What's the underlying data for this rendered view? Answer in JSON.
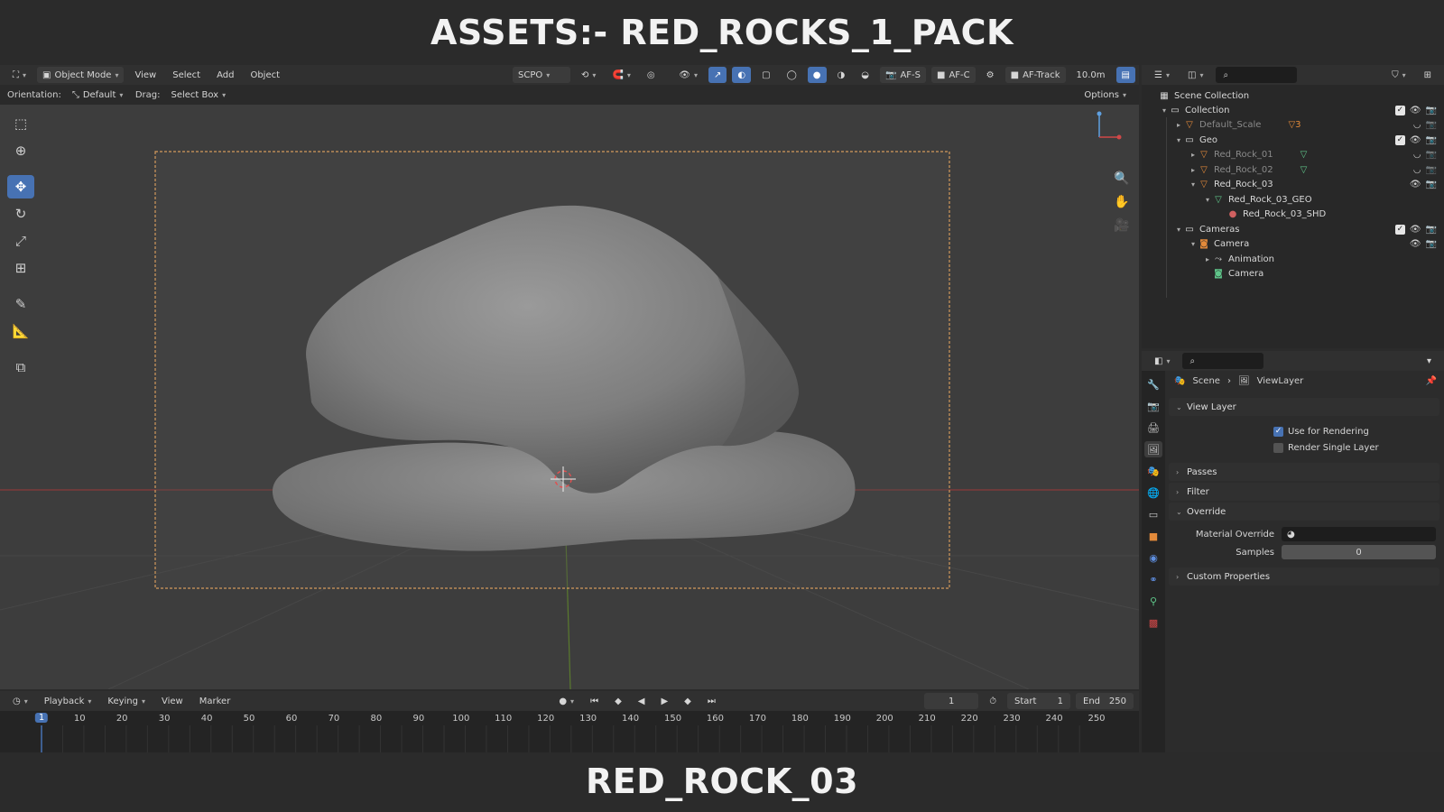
{
  "banner": {
    "top_title": "ASSETS:- RED_ROCKS_1_PACK",
    "bottom_title": "RED_ROCK_03"
  },
  "viewport_header": {
    "mode": "Object Mode",
    "menus": [
      "View",
      "Select",
      "Add",
      "Object"
    ],
    "camera_name": "SCPO",
    "af_s": "AF-S",
    "af_c": "AF-C",
    "af_track": "AF-Track",
    "distance": "10.0m"
  },
  "tool_settings": {
    "orientation_label": "Orientation:",
    "orientation_value": "Default",
    "drag_label": "Drag:",
    "drag_value": "Select Box",
    "options_label": "Options"
  },
  "timeline": {
    "menus": [
      "Playback",
      "Keying",
      "View",
      "Marker"
    ],
    "current_frame": "1",
    "start_label": "Start",
    "start_value": "1",
    "end_label": "End",
    "end_value": "250",
    "ticks": [
      "10",
      "20",
      "30",
      "40",
      "50",
      "60",
      "70",
      "80",
      "90",
      "100",
      "110",
      "120",
      "130",
      "140",
      "150",
      "160",
      "170",
      "180",
      "190",
      "200",
      "210",
      "220",
      "230",
      "240",
      "250"
    ],
    "cursor_label": "1"
  },
  "outliner": {
    "root": "Scene Collection",
    "rows": [
      {
        "label": "Collection",
        "level": 1,
        "icon": "collection-icon",
        "expanded": true,
        "dim": false
      },
      {
        "label": "Default_Scale",
        "level": 2,
        "icon": "mesh-icon",
        "expanded": false,
        "dim": true
      },
      {
        "label": "Geo",
        "level": 2,
        "icon": "collection-icon",
        "expanded": true,
        "dim": false
      },
      {
        "label": "Red_Rock_01",
        "level": 3,
        "icon": "mesh-icon",
        "expanded": false,
        "dim": true
      },
      {
        "label": "Red_Rock_02",
        "level": 3,
        "icon": "mesh-icon",
        "expanded": false,
        "dim": true
      },
      {
        "label": "Red_Rock_03",
        "level": 3,
        "icon": "mesh-icon",
        "expanded": true,
        "dim": false
      },
      {
        "label": "Red_Rock_03_GEO",
        "level": 4,
        "icon": "mesh-data-icon",
        "expanded": true,
        "dim": false
      },
      {
        "label": "Red_Rock_03_SHD",
        "level": 5,
        "icon": "material-icon",
        "expanded": false,
        "dim": false
      },
      {
        "label": "Cameras",
        "level": 2,
        "icon": "collection-icon",
        "expanded": true,
        "dim": false
      },
      {
        "label": "Camera",
        "level": 3,
        "icon": "camera-object-icon",
        "expanded": true,
        "dim": false
      },
      {
        "label": "Animation",
        "level": 4,
        "icon": "animation-icon",
        "expanded": false,
        "dim": false
      },
      {
        "label": "Camera",
        "level": 4,
        "icon": "camera-data-icon",
        "expanded": false,
        "dim": false
      }
    ],
    "default_scale_badge": "3"
  },
  "properties": {
    "breadcrumb_scene": "Scene",
    "breadcrumb_layer": "ViewLayer",
    "panels": {
      "view_layer": "View Layer",
      "use_for_rendering": "Use for Rendering",
      "render_single_layer": "Render Single Layer",
      "passes": "Passes",
      "filter": "Filter",
      "override": "Override",
      "material_override": "Material Override",
      "samples_label": "Samples",
      "samples_value": "0",
      "custom_properties": "Custom Properties"
    }
  },
  "colors": {
    "accent": "#4772b3",
    "mesh_orange": "#e38a3a",
    "mesh_data_green": "#5fc68a",
    "x_axis": "#b54646",
    "y_axis": "#6a9b3a"
  }
}
